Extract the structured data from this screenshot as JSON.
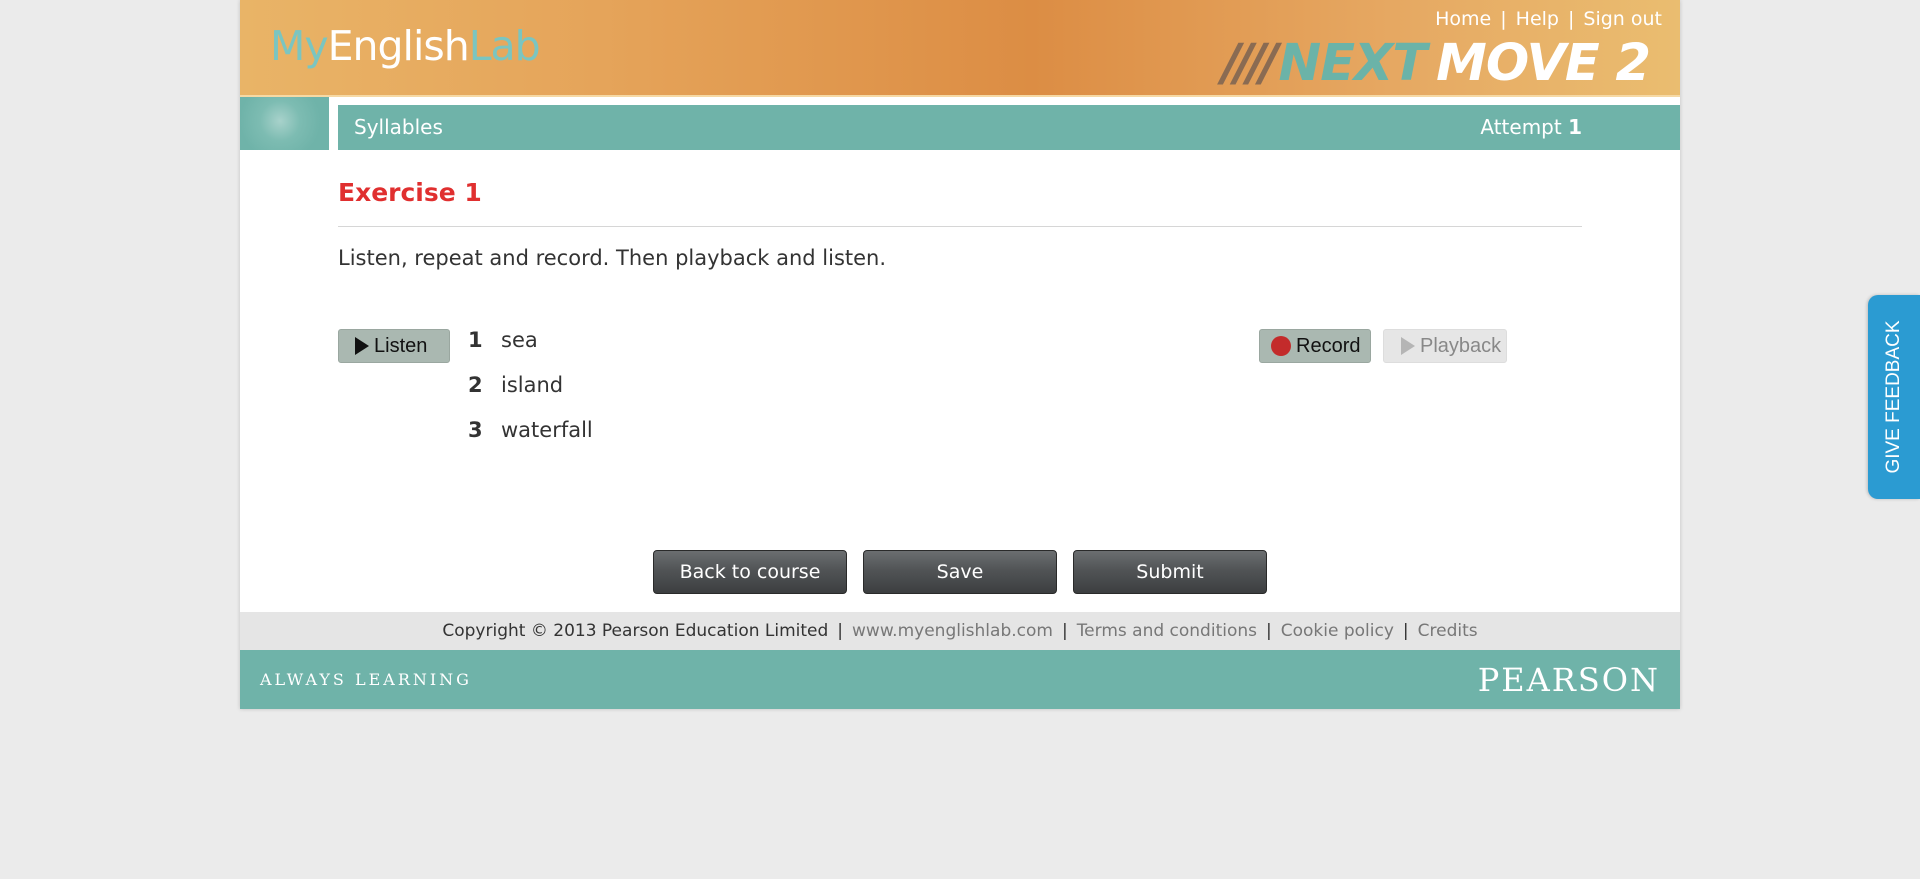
{
  "header": {
    "logo_part1": "My",
    "logo_part2": "English",
    "logo_part3": "Lab",
    "links": [
      "Home",
      "Help",
      "Sign out"
    ],
    "brand_next": "NEXT",
    "brand_move": "MOVE 2"
  },
  "titlebar": {
    "section": "Syllables",
    "attempt_label": "Attempt",
    "attempt_number": "1"
  },
  "exercise": {
    "title": "Exercise 1",
    "instructions": "Listen, repeat and record. Then playback and listen.",
    "listen_label": "Listen",
    "record_label": "Record",
    "playback_label": "Playback",
    "items": [
      {
        "num": "1",
        "word": "sea"
      },
      {
        "num": "2",
        "word": "island"
      },
      {
        "num": "3",
        "word": "waterfall"
      }
    ]
  },
  "actions": {
    "back": "Back to course",
    "save": "Save",
    "submit": "Submit"
  },
  "footer": {
    "copyright": "Copyright © 2013 Pearson Education Limited",
    "links": [
      "www.myenglishlab.com",
      "Terms and conditions",
      "Cookie policy",
      "Credits"
    ],
    "tagline": "ALWAYS LEARNING",
    "brand": "PEARSON"
  },
  "feedback_tab": "GIVE FEEDBACK",
  "colors": {
    "header_orange": "#dc8d44",
    "teal": "#6fb3a9",
    "exercise_red": "#e02f2f",
    "record_red": "#c32b2b",
    "feedback_blue": "#2b9bd2"
  }
}
